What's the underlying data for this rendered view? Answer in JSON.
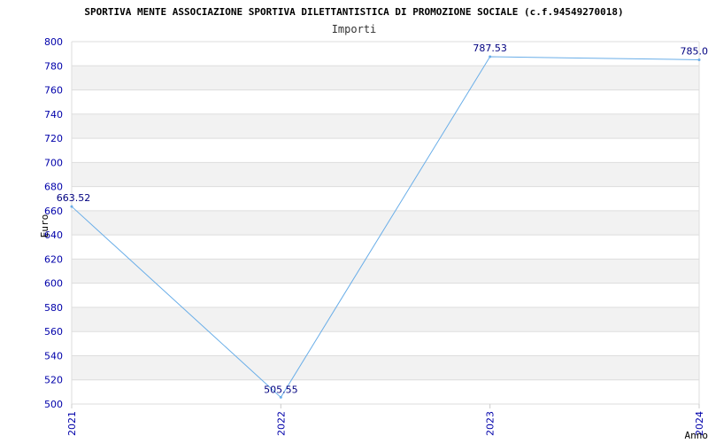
{
  "chart_data": {
    "type": "line",
    "title": "SPORTIVA MENTE ASSOCIAZIONE SPORTIVA DILETTANTISTICA DI PROMOZIONE SOCIALE (c.f.94549270018)",
    "subtitle": "Importi",
    "xlabel": "Anno",
    "ylabel": "Euro",
    "categories": [
      "2021",
      "2022",
      "2023",
      "2024"
    ],
    "series": [
      {
        "values": [
          663.52,
          505.55,
          787.53,
          785.0
        ],
        "labels": [
          "663.52",
          "505.55",
          "787.53",
          "785.0"
        ],
        "color": "#6aaee8"
      }
    ],
    "ylim": [
      500,
      800
    ],
    "yticks": [
      500,
      520,
      540,
      560,
      580,
      600,
      620,
      640,
      660,
      680,
      700,
      720,
      740,
      760,
      780,
      800
    ],
    "grid": true,
    "band_colors": [
      "#ffffff",
      "#f2f2f2"
    ],
    "tick_label_color": "#0000aa",
    "data_label_color": "#000080",
    "legend": "none"
  }
}
